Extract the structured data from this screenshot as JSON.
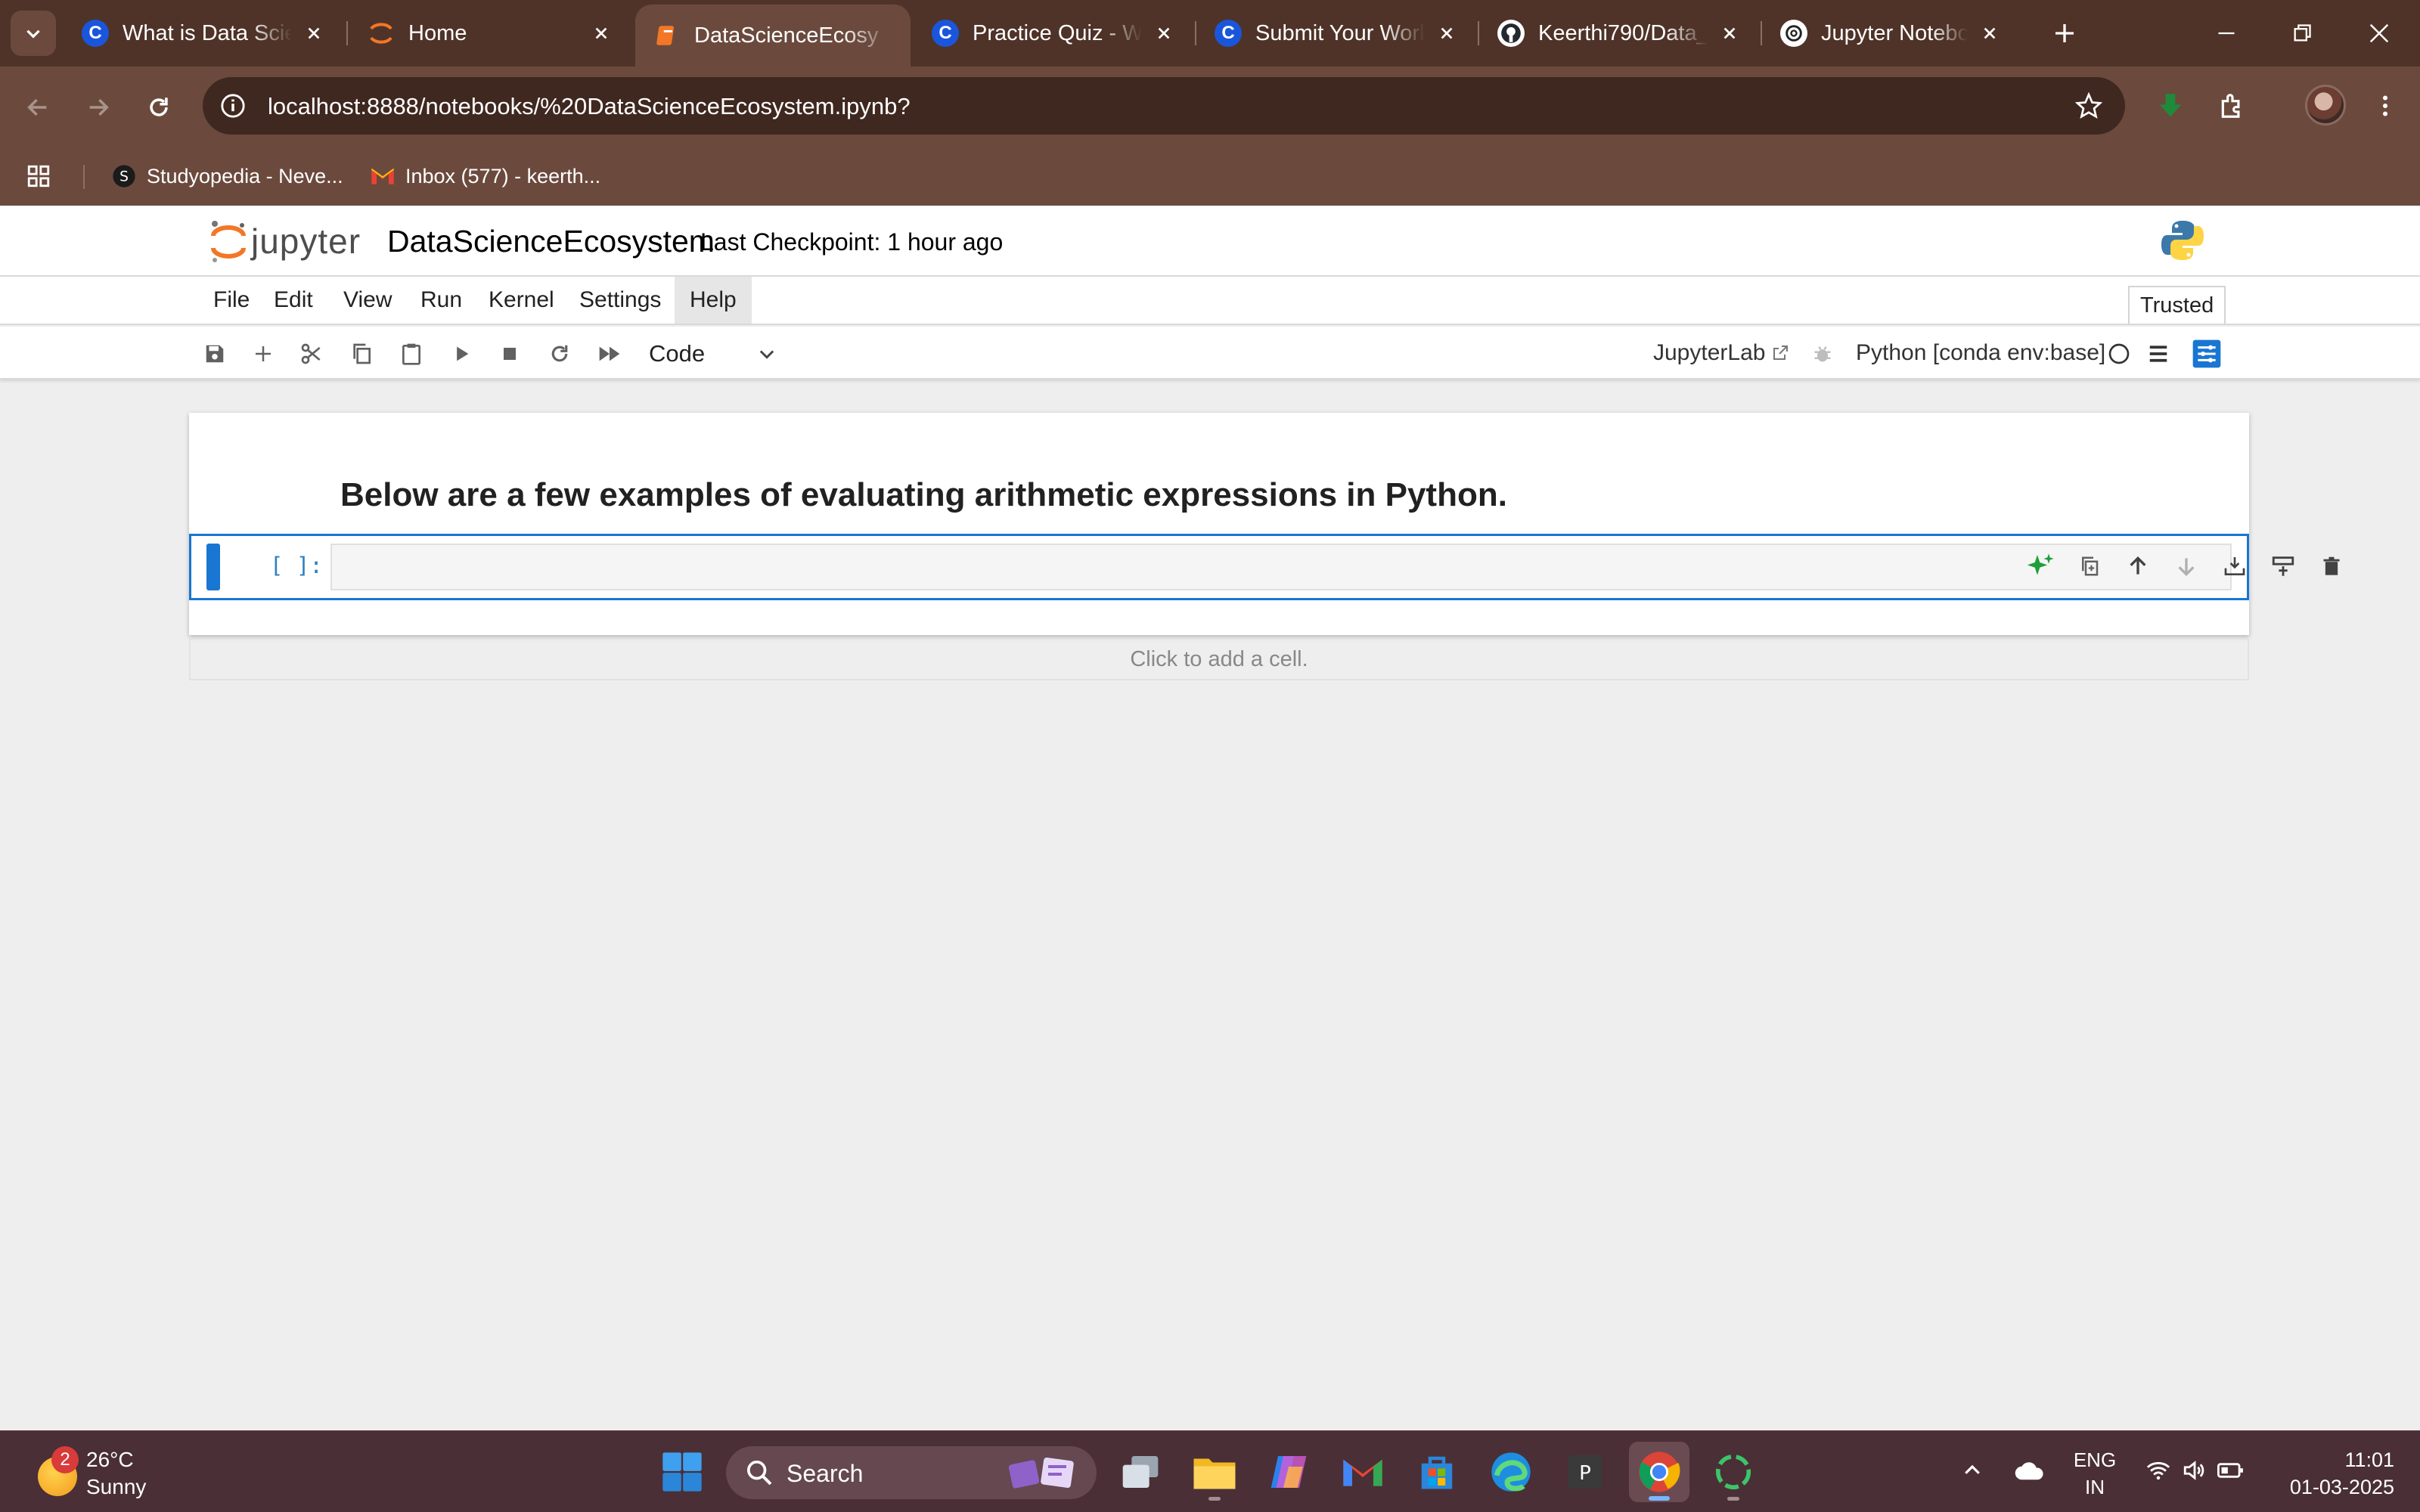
{
  "browser": {
    "tabs": [
      {
        "title": "What is Data Scien",
        "favicon": "coursera-icon",
        "active": false
      },
      {
        "title": "Home",
        "favicon": "jupyter-icon",
        "active": false
      },
      {
        "title": "DataScienceEcosy",
        "favicon": "notebook-icon",
        "active": true
      },
      {
        "title": "Practice Quiz - Wa",
        "favicon": "coursera-icon",
        "active": false
      },
      {
        "title": "Submit Your Work",
        "favicon": "coursera-icon",
        "active": false
      },
      {
        "title": "Keerthi790/Data_S",
        "favicon": "github-icon",
        "active": false
      },
      {
        "title": "Jupyter Notebook",
        "favicon": "chatgpt-icon",
        "active": false
      }
    ],
    "url": "localhost:8888/notebooks/%20DataScienceEcosystem.ipynb?",
    "bookmarks": [
      {
        "label": "Studyopedia - Neve...",
        "icon": "studyopedia-icon"
      },
      {
        "label": "Inbox (577) - keerth...",
        "icon": "gmail-icon"
      }
    ]
  },
  "jupyter": {
    "logo_text": "jupyter",
    "notebook_title": "DataScienceEcosystem",
    "checkpoint": "Last Checkpoint: 1 hour ago",
    "menu": [
      "File",
      "Edit",
      "View",
      "Run",
      "Kernel",
      "Settings",
      "Help"
    ],
    "trusted": "Trusted",
    "cell_type": "Code",
    "jupyterlab_link": "JupyterLab",
    "kernel": "Python [conda env:base]",
    "markdown_text": "Below are a few examples of evaluating arithmetic expressions in Python.",
    "code_prompt": "[ ]:",
    "code_content": "",
    "add_cell_hint": "Click to add a cell."
  },
  "taskbar": {
    "weather_temp": "26°C",
    "weather_condition": "Sunny",
    "weather_badge": "2",
    "search_label": "Search",
    "lang_line1": "ENG",
    "lang_line2": "IN",
    "time": "11:01",
    "date": "01-03-2025"
  },
  "colors": {
    "browser_frame": "#4f3328",
    "browser_toolbar": "#6b4a3d",
    "jupyter_accent": "#1976d2",
    "taskbar": "#4a2f36"
  }
}
